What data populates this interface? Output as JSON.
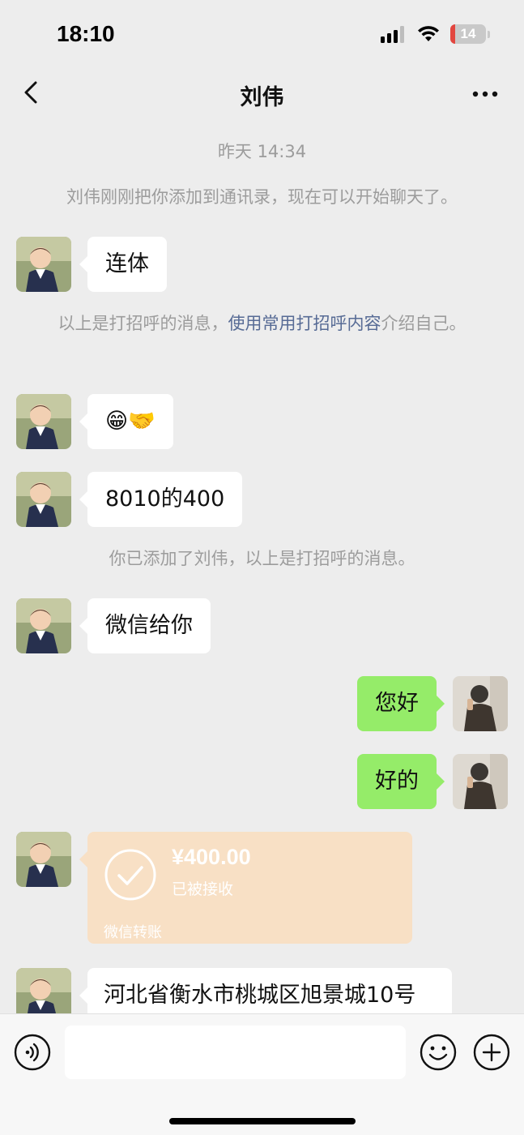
{
  "status_bar": {
    "time": "18:10",
    "battery_level": "14",
    "battery_fraction": 0.14
  },
  "nav": {
    "title": "刘伟"
  },
  "messages": {
    "timestamp": "昨天 14:34",
    "added_notice": "刘伟刚刚把你添加到通讯录，现在可以开始聊天了。",
    "msg1": "连体",
    "greeting_notice_pre": "以上是打招呼的消息，",
    "greeting_notice_link": "使用常用打招呼内容",
    "greeting_notice_post": "介绍自己。",
    "msg2_emoji": "😁🤝",
    "msg3": "8010的400",
    "added_you_notice": "你已添加了刘伟，以上是打招呼的消息。",
    "msg4": "微信给你",
    "msg5_self": "您好",
    "msg6_self": "好的",
    "transfer": {
      "amount": "¥400.00",
      "status": "已被接收",
      "label": "微信转账"
    },
    "msg7": "河北省衡水市桃城区旭景城10号"
  },
  "icons": {
    "back": "chevron-left-icon",
    "more": "more-dots-icon",
    "voice": "voice-icon",
    "emoji": "emoji-icon",
    "plus": "plus-icon"
  },
  "colors": {
    "background": "#ededed",
    "self_bubble": "#95ec69",
    "other_bubble": "#ffffff",
    "transfer_bubble": "#f8e0c5",
    "link": "#576b95",
    "system_text": "#9c9c9c"
  }
}
